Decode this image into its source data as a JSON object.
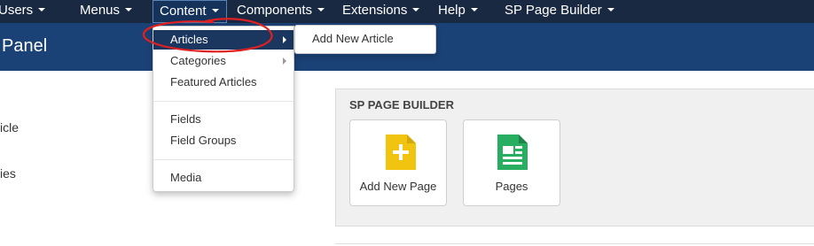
{
  "nav": {
    "items": [
      {
        "label": "Users"
      },
      {
        "label": "Menus"
      },
      {
        "label": "Content"
      },
      {
        "label": "Components"
      },
      {
        "label": "Extensions"
      },
      {
        "label": "Help"
      },
      {
        "label": "SP Page Builder"
      }
    ]
  },
  "header": {
    "title": "l Panel"
  },
  "left": {
    "line1": "icle",
    "line2": "ies"
  },
  "content_menu": {
    "items": [
      {
        "label": "Articles"
      },
      {
        "label": "Categories"
      },
      {
        "label": "Featured Articles"
      },
      {
        "label": "Fields"
      },
      {
        "label": "Field Groups"
      },
      {
        "label": "Media"
      }
    ]
  },
  "articles_submenu": {
    "items": [
      {
        "label": "Add New Article"
      }
    ]
  },
  "sp_page_builder": {
    "title": "SP PAGE BUILDER",
    "cards": [
      {
        "label": "Add New Page",
        "icon": "add-document-icon",
        "color": "#f1c40f"
      },
      {
        "label": "Pages",
        "icon": "pages-document-icon",
        "color": "#27ae60"
      }
    ]
  },
  "annotation": {
    "color": "#e02020"
  }
}
